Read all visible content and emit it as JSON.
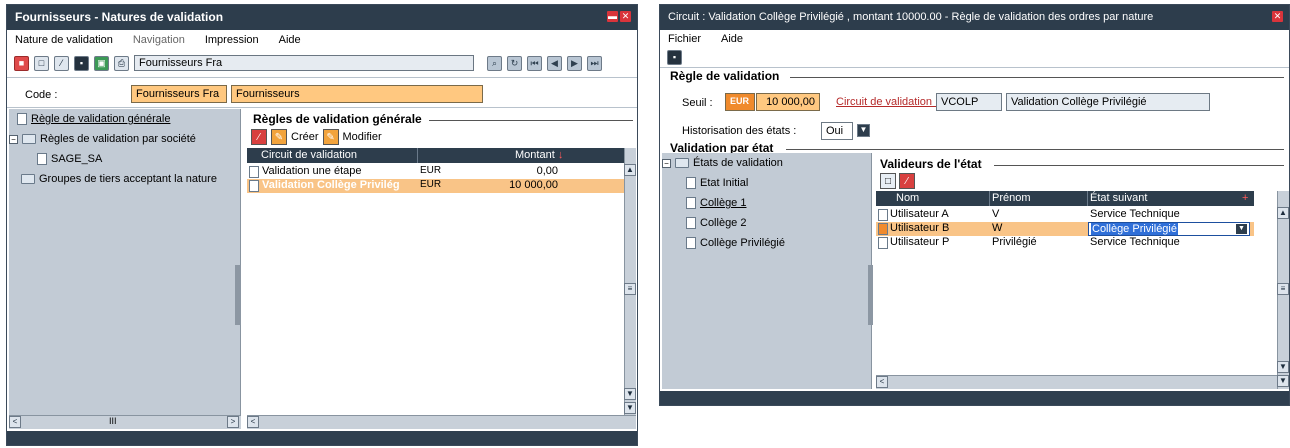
{
  "w1": {
    "title": "Fournisseurs -  Natures de validation",
    "menu": [
      "Nature de validation",
      "Navigation",
      "Impression",
      "Aide"
    ],
    "nav_field": "Fournisseurs Fra",
    "code_label": "Code :",
    "code_value": "Fournisseurs Fra",
    "code_desc": "Fournisseurs",
    "tree": [
      "Règle de validation générale",
      "Règles de validation par société",
      "SAGE_SA",
      "Groupes de tiers acceptant la nature"
    ],
    "section_title": "Règles de validation générale",
    "create_label": "Créer",
    "modify_label": "Modifier",
    "columns": [
      "Circuit de validation",
      "Montant"
    ],
    "rows": [
      {
        "name": "Validation une étape",
        "currency": "EUR",
        "amount": "0,00"
      },
      {
        "name": "Validation Collège Privilég",
        "currency": "EUR",
        "amount": "10 000,00"
      }
    ],
    "hscroll_thumb": "III"
  },
  "w2": {
    "title": "Circuit : Validation Collège Privilégié , montant 10000.00 -  Règle de validation des ordres par nature",
    "menu": [
      "Fichier",
      "Aide"
    ],
    "section1": "Règle de validation",
    "seuil_label": "Seuil :",
    "seuil_currency": "EUR",
    "seuil_amount": "10 000,00",
    "circuit_label": "Circuit de validation :",
    "circuit_code": "VCOLP",
    "circuit_desc": "Validation Collège Privilégié",
    "histo_label": "Historisation des états :",
    "histo_value": "Oui",
    "section2": "Validation par état",
    "tree": [
      "États de validation",
      "Etat Initial",
      "Collège 1",
      "Collège 2",
      "Collège Privilégié"
    ],
    "section3": "Valideurs de l'état",
    "columns": [
      "Nom",
      "Prénom",
      "État suivant"
    ],
    "rows": [
      {
        "nom": "Utilisateur A",
        "prenom": "V",
        "etat": "Service Technique"
      },
      {
        "nom": "Utilisateur B",
        "prenom": "W",
        "etat": "Collège Privilégié"
      },
      {
        "nom": "Utilisateur P",
        "prenom": "Privilégié",
        "etat": "Service Technique"
      }
    ]
  },
  "colors": {
    "titlebar": "#2d3d4c",
    "selection": "#f9c487",
    "field_orange": "#ffc880",
    "pane": "#c2cbd5"
  }
}
